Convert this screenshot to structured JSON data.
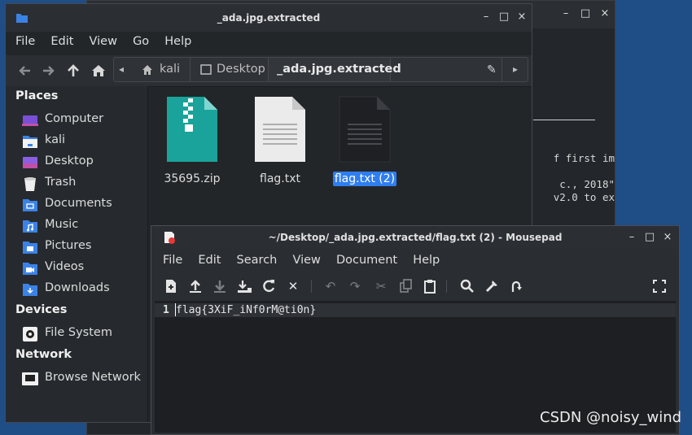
{
  "background_window": {
    "controls": [
      "–",
      "□",
      "×"
    ],
    "lines": [
      "f first im",
      "c., 2018\"",
      "v2.0 to ex"
    ]
  },
  "file_manager": {
    "title": "_ada.jpg.extracted",
    "menu": [
      "File",
      "Edit",
      "View",
      "Go",
      "Help"
    ],
    "breadcrumbs": [
      {
        "label": "kali",
        "icon": "home-icon"
      },
      {
        "label": "Desktop"
      },
      {
        "label": "_ada.jpg.extracted",
        "active": true
      }
    ],
    "sidebar": {
      "places_heading": "Places",
      "places": [
        {
          "label": "Computer",
          "icon": "computer-icon"
        },
        {
          "label": "kali",
          "icon": "home-folder-icon"
        },
        {
          "label": "Desktop",
          "icon": "desktop-icon"
        },
        {
          "label": "Trash",
          "icon": "trash-icon"
        },
        {
          "label": "Documents",
          "icon": "documents-folder-icon"
        },
        {
          "label": "Music",
          "icon": "music-folder-icon"
        },
        {
          "label": "Pictures",
          "icon": "pictures-folder-icon"
        },
        {
          "label": "Videos",
          "icon": "videos-folder-icon"
        },
        {
          "label": "Downloads",
          "icon": "downloads-folder-icon"
        }
      ],
      "devices_heading": "Devices",
      "devices": [
        {
          "label": "File System",
          "icon": "drive-icon"
        }
      ],
      "network_heading": "Network",
      "network": [
        {
          "label": "Browse Network",
          "icon": "network-icon"
        }
      ]
    },
    "files": [
      {
        "name": "35695.zip",
        "icon": "zip-file-icon"
      },
      {
        "name": "flag.txt",
        "icon": "text-file-icon"
      },
      {
        "name": "flag.txt (2)",
        "icon": "dark-text-file-icon",
        "selected": true
      }
    ]
  },
  "mousepad": {
    "title": "~/Desktop/_ada.jpg.extracted/flag.txt (2) - Mousepad",
    "menu": [
      "File",
      "Edit",
      "Search",
      "View",
      "Document",
      "Help"
    ],
    "line_number": "1",
    "content": "flag{3XiF_iNf0rM@ti0n}"
  },
  "watermark": "CSDN @noisy_wind",
  "colors": {
    "selection": "#2f7ef0",
    "folder_blue": "#3b82e6",
    "zip_teal": "#1aa39a",
    "desktop_bg": "#1f4d86"
  }
}
